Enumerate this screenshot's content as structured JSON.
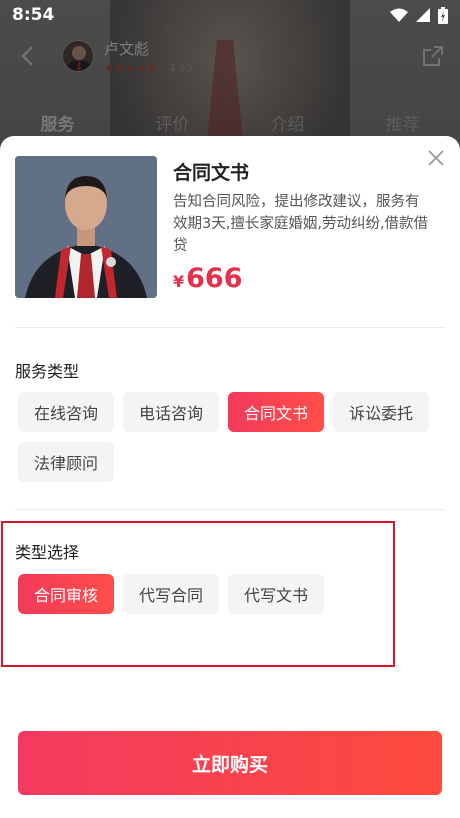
{
  "status_bar": {
    "time": "8:54",
    "icons": [
      "wifi-icon",
      "signal-icon",
      "battery-icon"
    ]
  },
  "background_page": {
    "lawyer_name": "卢文彪",
    "rating_score": "4.95",
    "stars": "★★★★★",
    "tabs": [
      {
        "label": "服务",
        "active": true
      },
      {
        "label": "评价",
        "active": false
      },
      {
        "label": "介绍",
        "active": false
      },
      {
        "label": "推荐",
        "active": false
      }
    ]
  },
  "sheet": {
    "product": {
      "title": "合同文书",
      "description": "告知合同风险，提出修改建议，服务有效期3天,擅长家庭婚姻,劳动纠纷,借款借贷",
      "currency": "¥",
      "price": "666"
    },
    "service_type": {
      "title": "服务类型",
      "options": [
        {
          "label": "在线咨询",
          "selected": false
        },
        {
          "label": "电话咨询",
          "selected": false
        },
        {
          "label": "合同文书",
          "selected": true
        },
        {
          "label": "诉讼委托",
          "selected": false
        },
        {
          "label": "法律顾问",
          "selected": false
        }
      ]
    },
    "type_selection": {
      "title": "类型选择",
      "options": [
        {
          "label": "合同审核",
          "selected": true
        },
        {
          "label": "代写合同",
          "selected": false
        },
        {
          "label": "代写文书",
          "selected": false
        }
      ]
    },
    "buy_button": "立即购买"
  },
  "colors": {
    "accent": "#f23a5a",
    "price": "#e5304a",
    "highlight_border": "#d0182a"
  }
}
